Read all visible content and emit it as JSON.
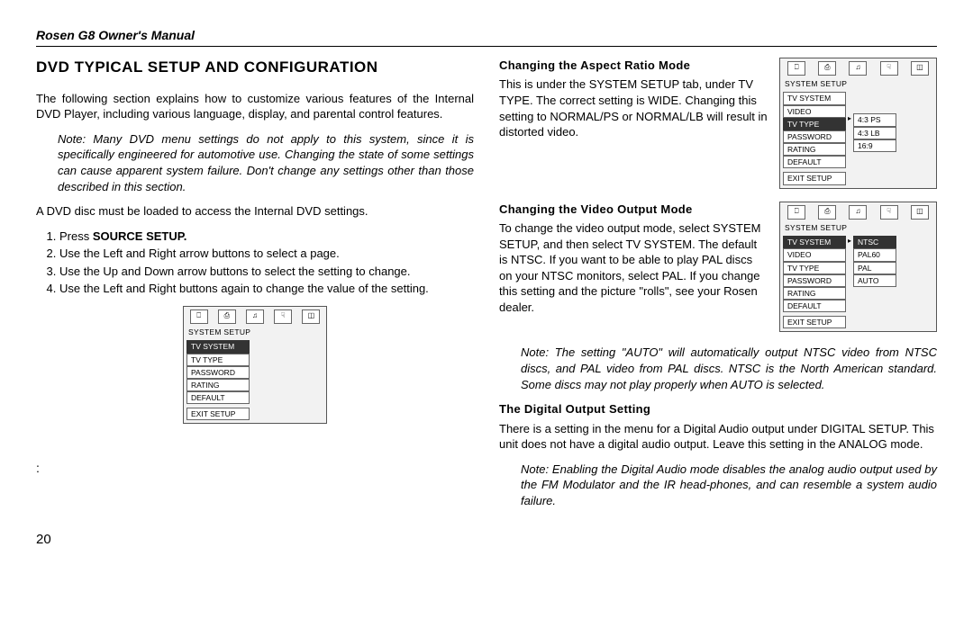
{
  "header": "Rosen G8 Owner's Manual",
  "pageNumber": "20",
  "left": {
    "title": "DVD TYPICAL SETUP AND CONFIGURATION",
    "intro": "The following section explains how to customize various features of the Internal DVD Player, including various language, display, and parental control features.",
    "note": "Note: Many DVD menu settings do not apply to this system, since it is specifically engineered for automotive use. Changing the state of some settings can cause apparent system failure. Don't change any settings other than those described in this section.",
    "loadLine": "A DVD disc must be loaded to access the Internal DVD settings.",
    "steps": {
      "s1_pre": "Press ",
      "s1_bold": "SOURCE SETUP.",
      "s2": "Use the Left and Right  arrow buttons to select a page.",
      "s3": "Use the Up and Down arrow buttons to select the setting to change.",
      "s4": "Use the Left and Right buttons again to change the value of the setting."
    },
    "colon": ":",
    "menu": {
      "group": "SYSTEM SETUP",
      "items": [
        "TV SYSTEM",
        "TV TYPE",
        "PASSWORD",
        "RATING",
        "DEFAULT",
        "EXIT SETUP"
      ],
      "selectedIndex": 0
    }
  },
  "right": {
    "aspect": {
      "heading": "Changing the Aspect Ratio Mode",
      "text": "This is under the SYSTEM SETUP tab, under TV TYPE. The correct setting is WIDE. Changing this setting to NORMAL/PS or NORMAL/LB will result in distorted video.",
      "menu": {
        "group": "SYSTEM SETUP",
        "items": [
          "TV SYSTEM",
          "VIDEO",
          "TV TYPE",
          "PASSWORD",
          "RATING",
          "DEFAULT",
          "EXIT SETUP"
        ],
        "selectedIndex": 2,
        "sub": [
          "4:3 PS",
          "4:3 LB",
          "16:9"
        ]
      }
    },
    "video": {
      "heading": "Changing the Video Output Mode",
      "text": "To change the video output mode, select SYSTEM SETUP, and then select TV SYSTEM. The default is NTSC. If you want to be able to play PAL discs on your NTSC monitors, select PAL. If you change this setting and the picture \"rolls\", see your Rosen dealer.",
      "menu": {
        "group": "SYSTEM SETUP",
        "items": [
          "TV SYSTEM",
          "VIDEO",
          "TV TYPE",
          "PASSWORD",
          "RATING",
          "DEFAULT",
          "EXIT SETUP"
        ],
        "selectedIndex": 0,
        "sub": [
          "NTSC",
          "PAL60",
          "PAL",
          "AUTO"
        ],
        "subSelectedIndex": 0
      },
      "note": "Note: The setting \"AUTO\" will automatically output NTSC video from NTSC discs, and PAL video from PAL discs. NTSC is the North American standard. Some discs may not play properly when AUTO is selected."
    },
    "digital": {
      "heading": "The Digital Output Setting",
      "text": "There is a setting in the menu for a Digital Audio output under DIGITAL SETUP. This unit does not have a digital audio output. Leave this setting in the ANALOG mode.",
      "note": "Note: Enabling the Digital Audio mode disables the analog audio output used by the FM Modulator and the IR head-phones, and can resemble a system audio failure."
    }
  },
  "tabIcons": [
    "⎕",
    "⎙",
    "♫",
    "☟",
    "◫"
  ]
}
